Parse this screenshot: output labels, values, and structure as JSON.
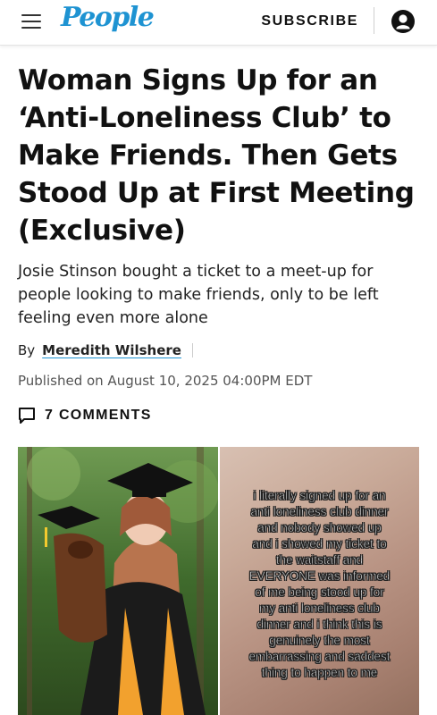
{
  "header": {
    "brand": "People",
    "subscribe_label": "SUBSCRIBE"
  },
  "article": {
    "headline": "Woman Signs Up for an ‘Anti-Loneliness Club’ to Make Friends. Then Gets Stood Up at First Meeting (Exclusive)",
    "dek": "Josie Stinson bought a ticket to a meet-up for people looking to make friends, only to be left feeling even more alone",
    "byline_prefix": "By",
    "author": "Meredith Wilshere",
    "published": "Published on August 10, 2025 04:00PM EDT",
    "comments_label": "7 COMMENTS"
  },
  "image": {
    "overlay_lines": [
      "i literally signed up for an",
      "anti loneliness club dinner",
      "and nobody showed up",
      "and i showed my ticket to",
      "the waitstaff and",
      "EVERYONE was informed",
      "of me being stood up for",
      "my anti loneliness club",
      "dinner and i think this is",
      "genuinely the most",
      "embarrassing and saddest",
      "thing to happen to me"
    ]
  },
  "icons": {
    "menu": "hamburger-menu-icon",
    "account": "account-icon",
    "comments": "comment-bubble-icon"
  },
  "colors": {
    "brand_blue": "#1e93d2",
    "text": "#111111"
  }
}
